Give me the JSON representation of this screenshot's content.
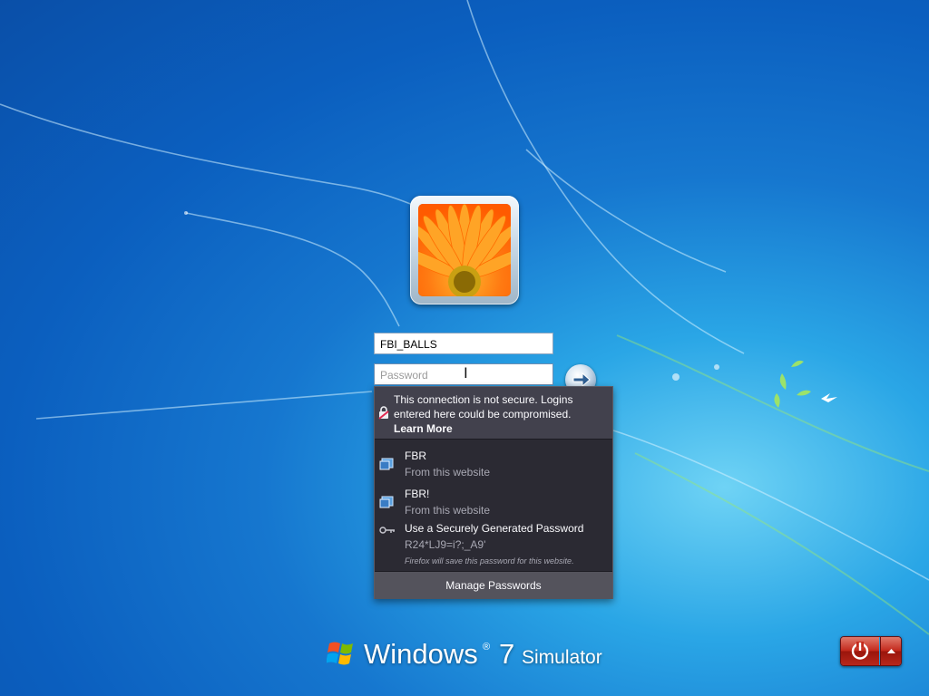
{
  "login": {
    "username_value": "FBI_BALLS",
    "password_placeholder": "Password"
  },
  "password_dropdown": {
    "warning_text": "This connection is not secure. Logins entered here could be compromised.",
    "learn_more": "Learn More",
    "entries": [
      {
        "title": "FBR",
        "subtitle": "From this website"
      },
      {
        "title": "FBR!",
        "subtitle": "From this website"
      }
    ],
    "generated": {
      "title": "Use a Securely Generated Password",
      "password": "R24*LJ9=i?;_A9'",
      "note": "Firefox will save this password for this website."
    },
    "manage_label": "Manage Passwords"
  },
  "branding": {
    "windows": "Windows",
    "registered": "®",
    "version": "7",
    "suffix": "Simulator"
  },
  "colors": {
    "desktop_blue": "#0b5fbf",
    "dropdown_bg": "#2b2a33",
    "power_red": "#c42a1d"
  },
  "icons": [
    "user-avatar",
    "go-arrow-icon",
    "lock-warning-icon",
    "site-icon",
    "key-icon",
    "windows-logo-icon",
    "power-icon",
    "chevron-up-icon"
  ]
}
